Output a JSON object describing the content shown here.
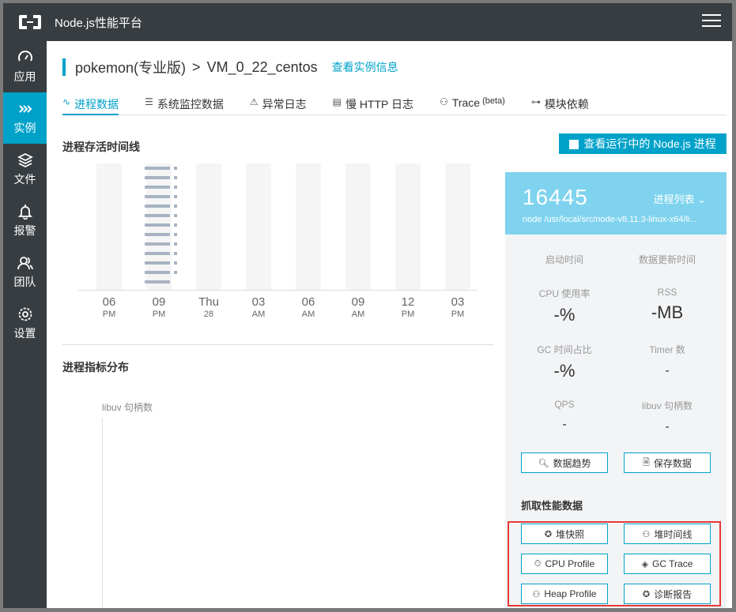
{
  "app": {
    "title": "Node.js性能平台",
    "logo_icon": "aliyun-logo-icon",
    "menu_icon": "hamburger-icon"
  },
  "sidebar": {
    "items": [
      {
        "label": "应用",
        "icon": "gauge-icon"
      },
      {
        "label": "实例",
        "icon": "chevrons-right-icon",
        "active": true
      },
      {
        "label": "文件",
        "icon": "layers-icon"
      },
      {
        "label": "报警",
        "icon": "bell-icon"
      },
      {
        "label": "团队",
        "icon": "users-icon"
      },
      {
        "label": "设置",
        "icon": "gear-icon"
      }
    ]
  },
  "breadcrumb": {
    "app": "pokemon(专业版)",
    "sep": ">",
    "instance": "VM_0_22_centos",
    "link": "查看实例信息"
  },
  "tabs": [
    {
      "label": "进程数据",
      "icon": "pulse-icon",
      "active": true
    },
    {
      "label": "系统监控数据",
      "icon": "server-icon"
    },
    {
      "label": "异常日志",
      "icon": "warning-icon"
    },
    {
      "label": "慢 HTTP 日志",
      "icon": "clipboard-icon"
    },
    {
      "label": "Trace",
      "suffix": "(beta)",
      "icon": "trace-icon"
    },
    {
      "label": "模块依赖",
      "icon": "sitemap-icon"
    }
  ],
  "timeline": {
    "title": "进程存活时间线",
    "labels": [
      {
        "a": "06",
        "b": "PM"
      },
      {
        "a": "09",
        "b": "PM"
      },
      {
        "a": "Thu",
        "b": "28"
      },
      {
        "a": "03",
        "b": "AM"
      },
      {
        "a": "06",
        "b": "AM"
      },
      {
        "a": "09",
        "b": "AM"
      },
      {
        "a": "12",
        "b": "PM"
      },
      {
        "a": "03",
        "b": "PM"
      }
    ]
  },
  "metrics_section": {
    "title": "进程指标分布",
    "libuv_label": "libuv 句柄数"
  },
  "view_running_button": "查看运行中的 Node.js 进程",
  "process": {
    "pid": "16445",
    "list_label": "进程列表",
    "command": "node /usr/local/src/node-v8.11.3-linux-x64/li...",
    "start_time_label": "启动时间",
    "update_time_label": "数据更新时间",
    "cpu_label": "CPU 使用率",
    "cpu_value": "-%",
    "rss_label": "RSS",
    "rss_value": "-MB",
    "gc_label": "GC 时间占比",
    "gc_value": "-%",
    "timer_label": "Timer 数",
    "timer_value": "-",
    "qps_label": "QPS",
    "qps_value": "-",
    "libuv_label": "libuv 句柄数",
    "libuv_value": "-"
  },
  "actions": {
    "trend": "数据趋势",
    "save": "保存数据"
  },
  "grab": {
    "title": "抓取性能数据",
    "heap_snapshot": "堆快照",
    "heap_timeline": "堆时间线",
    "cpu_profile": "CPU Profile",
    "gc_trace": "GC Trace",
    "heap_profile": "Heap Profile",
    "diagnose": "诊断报告"
  },
  "colors": {
    "accent": "#00a2ca",
    "sidebar": "#373d41",
    "highlight": "#e53935"
  }
}
